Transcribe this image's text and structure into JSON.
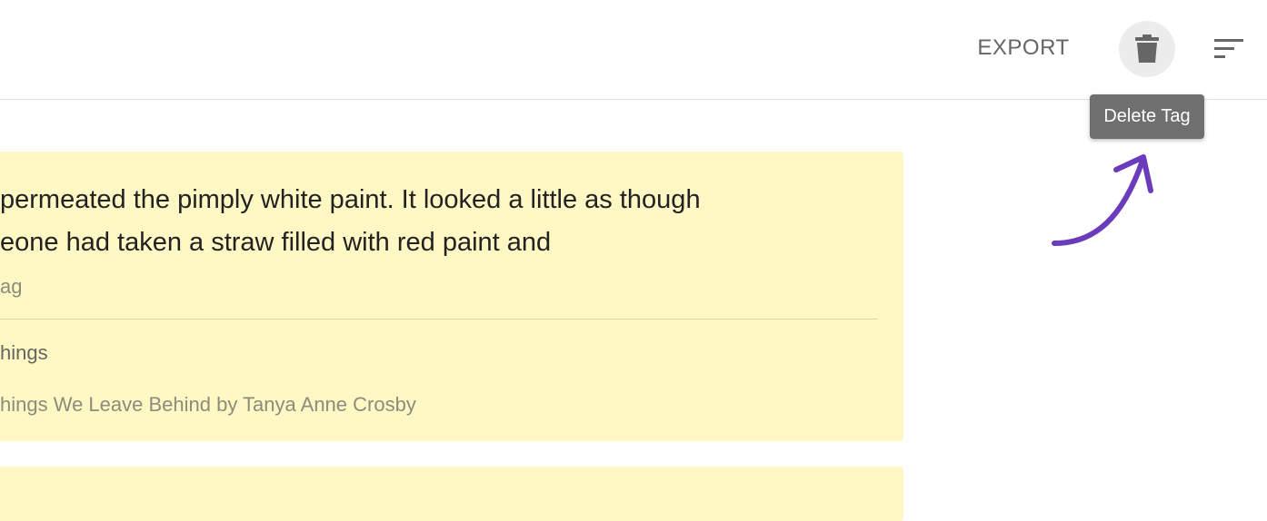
{
  "toolbar": {
    "export_label": "EXPORT",
    "delete_tooltip": "Delete Tag"
  },
  "highlights": [
    {
      "text": "permeated the pimply white paint. It looked a little as though\neone had taken a straw filled with red paint and",
      "tag": "ag",
      "book_short": "hings",
      "book_full": "hings We Leave Behind by Tanya Anne Crosby"
    }
  ],
  "colors": {
    "card_background": "#fff8c4",
    "tooltip_background": "#6f6f6f",
    "annotation_arrow": "#6a3bbd",
    "delete_button_background": "#ececec",
    "icon_color": "#666666"
  },
  "icons": {
    "delete": "trash-icon",
    "sort": "sort-icon",
    "annotation": "curved-arrow-icon"
  }
}
